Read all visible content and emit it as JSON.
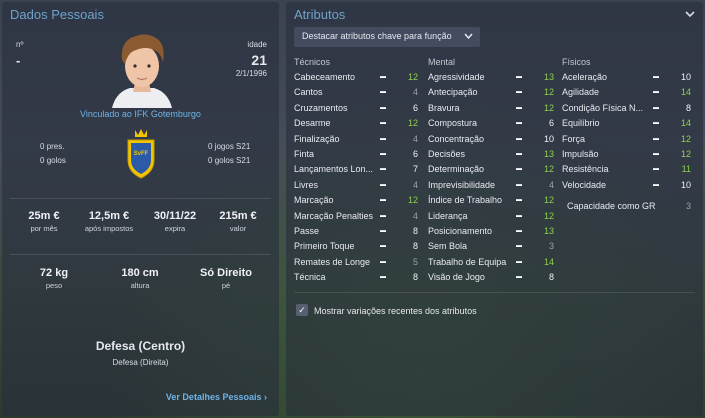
{
  "personal": {
    "title": "Dados Pessoais",
    "number_label": "nº",
    "number_value": "-",
    "age_label": "idade",
    "age_value": "21",
    "dob": "2/1/1996",
    "club_link": "Vinculado ao IFK Gotemburgo",
    "caps_left_value": "0",
    "caps_left_label": "pres.",
    "goals_left_value": "0",
    "goals_left_label": "golos",
    "caps_right_value": "0",
    "caps_right_label": "jogos S21",
    "goals_right_value": "0",
    "goals_right_label": "golos S21",
    "finance": [
      {
        "value": "25m €",
        "label": "por mês"
      },
      {
        "value": "12,5m €",
        "label": "após impostos"
      },
      {
        "value": "30/11/22",
        "label": "expira"
      },
      {
        "value": "215m €",
        "label": "valor"
      }
    ],
    "physical": [
      {
        "value": "72 kg",
        "label": "peso"
      },
      {
        "value": "180 cm",
        "label": "altura"
      },
      {
        "value": "Só Direito",
        "label": "pé"
      }
    ],
    "position_main": "Defesa (Centro)",
    "position_sub": "Defesa (Direita)",
    "details_link": "Ver Detalhes Pessoais",
    "details_chevron": "›"
  },
  "attributes": {
    "title": "Atributos",
    "collapse_icon": "chevron-down",
    "dropdown_label": "Destacar atributos chave para função",
    "columns": {
      "technical": {
        "header": "Técnicos",
        "rows": [
          {
            "name": "Cabeceamento",
            "value": "12",
            "hl": "g"
          },
          {
            "name": "Cantos",
            "value": "4",
            "hl": "d"
          },
          {
            "name": "Cruzamentos",
            "value": "6",
            "hl": "w"
          },
          {
            "name": "Desarme",
            "value": "12",
            "hl": "g"
          },
          {
            "name": "Finalização",
            "value": "4",
            "hl": "d"
          },
          {
            "name": "Finta",
            "value": "6",
            "hl": "w"
          },
          {
            "name": "Lançamentos Lon...",
            "value": "7",
            "hl": "w"
          },
          {
            "name": "Livres",
            "value": "4",
            "hl": "d"
          },
          {
            "name": "Marcação",
            "value": "12",
            "hl": "g"
          },
          {
            "name": "Marcação Penalties",
            "value": "4",
            "hl": "d"
          },
          {
            "name": "Passe",
            "value": "8",
            "hl": "w"
          },
          {
            "name": "Primeiro Toque",
            "value": "8",
            "hl": "w"
          },
          {
            "name": "Remates de Longe",
            "value": "5",
            "hl": "d"
          },
          {
            "name": "Técnica",
            "value": "8",
            "hl": "w"
          }
        ]
      },
      "mental": {
        "header": "Mental",
        "rows": [
          {
            "name": "Agressividade",
            "value": "13",
            "hl": "g"
          },
          {
            "name": "Antecipação",
            "value": "12",
            "hl": "g"
          },
          {
            "name": "Bravura",
            "value": "12",
            "hl": "g"
          },
          {
            "name": "Compostura",
            "value": "6",
            "hl": "w"
          },
          {
            "name": "Concentração",
            "value": "10",
            "hl": "w"
          },
          {
            "name": "Decisões",
            "value": "13",
            "hl": "g"
          },
          {
            "name": "Determinação",
            "value": "12",
            "hl": "g"
          },
          {
            "name": "Imprevisibilidade",
            "value": "4",
            "hl": "d"
          },
          {
            "name": "Índice de Trabalho",
            "value": "12",
            "hl": "g"
          },
          {
            "name": "Liderança",
            "value": "12",
            "hl": "g"
          },
          {
            "name": "Posicionamento",
            "value": "13",
            "hl": "g"
          },
          {
            "name": "Sem Bola",
            "value": "3",
            "hl": "d"
          },
          {
            "name": "Trabalho de Equipa",
            "value": "14",
            "hl": "g"
          },
          {
            "name": "Visão de Jogo",
            "value": "8",
            "hl": "w"
          }
        ]
      },
      "physical": {
        "header": "Físicos",
        "rows": [
          {
            "name": "Aceleração",
            "value": "10",
            "hl": "w"
          },
          {
            "name": "Agilidade",
            "value": "14",
            "hl": "g"
          },
          {
            "name": "Condição Física N...",
            "value": "8",
            "hl": "w"
          },
          {
            "name": "Equilíbrio",
            "value": "14",
            "hl": "g"
          },
          {
            "name": "Força",
            "value": "12",
            "hl": "g"
          },
          {
            "name": "Impulsão",
            "value": "12",
            "hl": "g"
          },
          {
            "name": "Resistência",
            "value": "11",
            "hl": "g"
          },
          {
            "name": "Velocidade",
            "value": "10",
            "hl": "w"
          }
        ]
      }
    },
    "gk_label": "Capacidade como GR",
    "gk_value": "3",
    "toggle_label": "Mostrar variações recentes dos atributos",
    "toggle_checked": true
  }
}
